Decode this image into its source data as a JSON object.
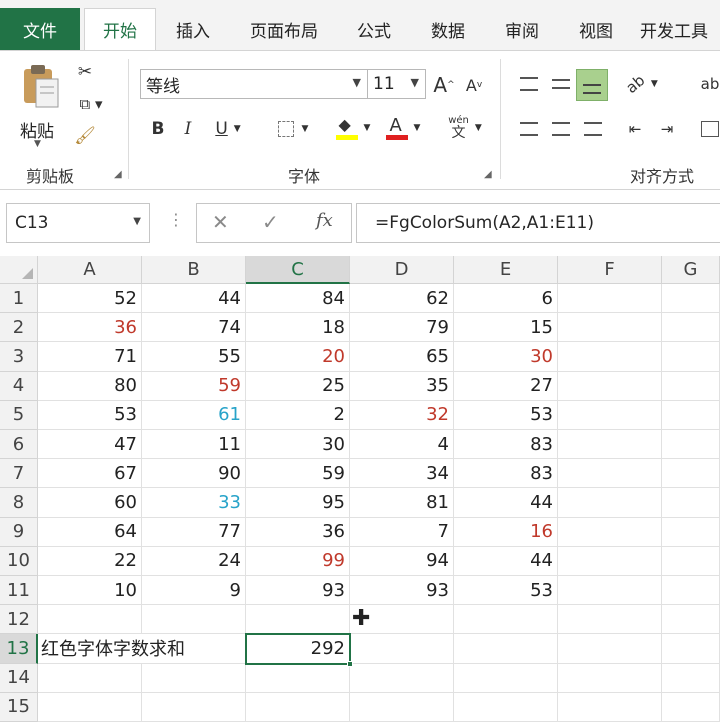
{
  "tabs": {
    "file": "文件",
    "items": [
      "开始",
      "插入",
      "页面布局",
      "公式",
      "数据",
      "审阅",
      "视图",
      "开发工具"
    ]
  },
  "ribbon": {
    "clipboard": {
      "paste_label": "粘贴",
      "group_label": "剪贴板"
    },
    "font": {
      "font_name": "等线",
      "font_size": "11",
      "bold": "B",
      "italic": "I",
      "underline": "U",
      "font_color_glyph": "A",
      "phonetic_top": "wén",
      "phonetic_bottom": "文",
      "grow": "A",
      "shrink": "A",
      "group_label": "字体"
    },
    "alignment": {
      "group_label": "对齐方式",
      "wrap_label": "ab"
    }
  },
  "formula_bar": {
    "name_box": "C13",
    "fx": "fx",
    "formula": "=FgColorSum(A2,A1:E11)"
  },
  "grid": {
    "columns": [
      "A",
      "B",
      "C",
      "D",
      "E",
      "F",
      "G"
    ],
    "rows": [
      "1",
      "2",
      "3",
      "4",
      "5",
      "6",
      "7",
      "8",
      "9",
      "10",
      "11",
      "12",
      "13",
      "14",
      "15"
    ],
    "data": [
      [
        "52",
        "44",
        "84",
        "62",
        "6"
      ],
      [
        "36",
        "74",
        "18",
        "79",
        "15"
      ],
      [
        "71",
        "55",
        "20",
        "65",
        "30"
      ],
      [
        "80",
        "59",
        "25",
        "35",
        "27"
      ],
      [
        "53",
        "61",
        "2",
        "32",
        "53"
      ],
      [
        "47",
        "11",
        "30",
        "4",
        "83"
      ],
      [
        "67",
        "90",
        "59",
        "34",
        "83"
      ],
      [
        "60",
        "33",
        "95",
        "81",
        "44"
      ],
      [
        "64",
        "77",
        "36",
        "7",
        "16"
      ],
      [
        "22",
        "24",
        "99",
        "94",
        "44"
      ],
      [
        "10",
        "9",
        "93",
        "93",
        "53"
      ]
    ],
    "font_colors": [
      [
        "",
        "",
        "",
        "",
        ""
      ],
      [
        "red",
        "",
        "",
        "",
        ""
      ],
      [
        "",
        "",
        "red",
        "",
        "red"
      ],
      [
        "",
        "red",
        "",
        "",
        ""
      ],
      [
        "",
        "blue",
        "",
        "red",
        ""
      ],
      [
        "",
        "",
        "",
        "",
        ""
      ],
      [
        "",
        "",
        "",
        "",
        ""
      ],
      [
        "",
        "blue",
        "",
        "",
        ""
      ],
      [
        "",
        "",
        "",
        "",
        "red"
      ],
      [
        "",
        "",
        "red",
        "",
        ""
      ],
      [
        "",
        "",
        "",
        "",
        ""
      ]
    ],
    "colors": {
      "red": "#c0392b",
      "blue": "#27a3c9",
      "accent": "#217346"
    },
    "label_cell": "红色字体字数求和",
    "result_cell": "292",
    "selected_cell": "C13"
  }
}
